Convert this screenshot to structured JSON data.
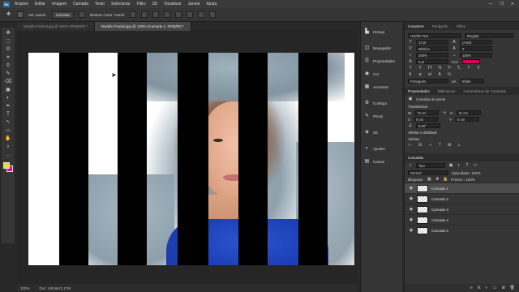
{
  "menubar": {
    "logo": "Ps",
    "items": [
      "Arquivo",
      "Editar",
      "Imagem",
      "Camada",
      "Texto",
      "Selecionar",
      "Filtro",
      "3D",
      "Visualizar",
      "Janela",
      "Ajuda"
    ],
    "win_controls": [
      "—",
      "❐",
      "✕"
    ]
  },
  "options": {
    "auto_select_label": "Sel. autom.",
    "auto_select_value": "Camada",
    "transform_label": "Mostrar Contr. Transf."
  },
  "tabs": [
    {
      "label": "Modelo Fractal.jpg @ 100% (RGB/8#) *",
      "active": false
    },
    {
      "label": "Modelo Fractal.jpg @ 100% (Camada 1, RGB/8#) *",
      "active": true
    }
  ],
  "tools": [
    "✥",
    "⬚",
    "ʘ",
    "⌗",
    "⚲",
    "✎",
    "⌫",
    "▣",
    "◐",
    "✒",
    "T",
    "↖",
    "▭",
    "✋",
    "⌕",
    "…"
  ],
  "colors": {
    "foreground": "#e8e600",
    "background": "#d20a8c",
    "accent": "#e0005a"
  },
  "status": {
    "zoom": "100%",
    "doc": "Doc: 440,6K/1,17M"
  },
  "panel_icons": [
    {
      "icon": "histogram-icon",
      "label": "Histogr."
    },
    {
      "icon": "navigator-icon",
      "label": "Navegador"
    },
    {
      "icon": "properties-icon",
      "label": "Propriedades"
    },
    {
      "icon": "swatches-icon",
      "label": "Cor"
    },
    {
      "icon": "styles-icon",
      "label": "Amostras"
    },
    {
      "icon": "adjust-icon",
      "label": "Configur."
    },
    {
      "icon": "brush-icon",
      "label": "Pincel"
    },
    {
      "icon": "3d-icon",
      "label": "3D"
    },
    {
      "icon": "paths-icon",
      "label": "Ajustes"
    },
    {
      "icon": "channels-icon",
      "label": "Canais"
    }
  ],
  "character": {
    "tabs": [
      "Caractere",
      "Parágrafo",
      "Glifos"
    ],
    "font": "Hoefler Text",
    "style": "Regular",
    "size": "12 pt",
    "leading": "(Auto)",
    "tracking": "Métrica",
    "kerning": "0",
    "vscale": "100%",
    "hscale": "100%",
    "baseline": "0 pt",
    "color_label": "Cor:",
    "language": "Português",
    "aa": "aA",
    "aa_mode": "Nítido"
  },
  "properties": {
    "tabs": [
      "Propriedades",
      "Bibliotecas",
      "Comentários de Conteúdo"
    ],
    "kind": "Camada de pixels",
    "transform_title": "Transformar",
    "w": "72 cm",
    "h": "31 cm",
    "x": "0 cm",
    "y": "0 cm",
    "angle": "0,00°",
    "align_title": "Alinhar e distribuir",
    "align_sub": "Alinhar:"
  },
  "layers": {
    "title": "Camadas",
    "filter": "Tipo",
    "mode": "Normal",
    "opacity": "Opacidade: 100%",
    "lock": "Bloquear:",
    "fill": "Preenc.: 100%",
    "items": [
      {
        "name": "Camada 1",
        "selected": true
      },
      {
        "name": "Camada 2",
        "selected": false
      },
      {
        "name": "Camada 3",
        "selected": false
      },
      {
        "name": "Camada 4",
        "selected": false
      },
      {
        "name": "Camada 5",
        "selected": false
      }
    ],
    "bottom_icons": [
      "∞",
      "fx",
      "◐",
      "▭",
      "⊞",
      "🗑"
    ]
  }
}
